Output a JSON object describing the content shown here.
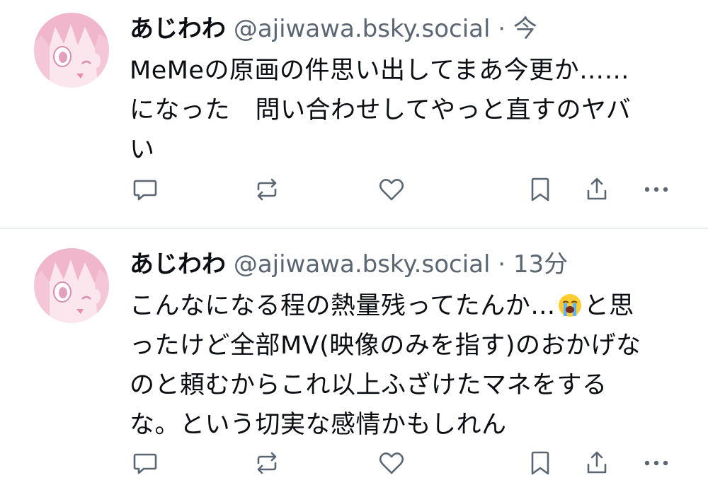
{
  "posts": [
    {
      "author": {
        "display_name": "あじわわ",
        "handle": "@ajiwawa.bsky.social"
      },
      "separator": "·",
      "time": "今",
      "text": "MeMeの原画の件思い出してまあ今更か……になった　問い合わせしてやっと直すのヤバい",
      "lines": [
        "MeMeの原画の件思い出してまあ今更か……",
        "になった　問い合わせしてやっと直すのヤバ",
        "い"
      ],
      "actions": [
        "reply-icon",
        "repost-icon",
        "like-icon",
        "bookmark-icon",
        "share-icon",
        "more-icon"
      ]
    },
    {
      "author": {
        "display_name": "あじわわ",
        "handle": "@ajiwawa.bsky.social"
      },
      "separator": "·",
      "time": "13分",
      "text": "こんなになる程の熱量残ってたんか…😭と思ったけど全部MV(映像のみを指す)のおかげなのと頼むからこれ以上ふざけたマネをするな。という切実な感情かもしれん",
      "lines": [
        "こんなになる程の熱量残ってたんか…",
        "と思",
        "ったけど全部MV(映像のみを指す)のおかげな",
        "のと頼むからこれ以上ふざけたマネをする",
        "な。という切実な感情かもしれん"
      ],
      "emoji": "loudly-crying-face-emoji",
      "actions": [
        "reply-icon",
        "repost-icon",
        "like-icon",
        "bookmark-icon",
        "share-icon",
        "more-icon"
      ]
    }
  ],
  "colors": {
    "text": "#0b0f14",
    "secondary": "#5b6673",
    "divider": "#e8ecf0",
    "avatar_pink": "#f3c3d6"
  }
}
